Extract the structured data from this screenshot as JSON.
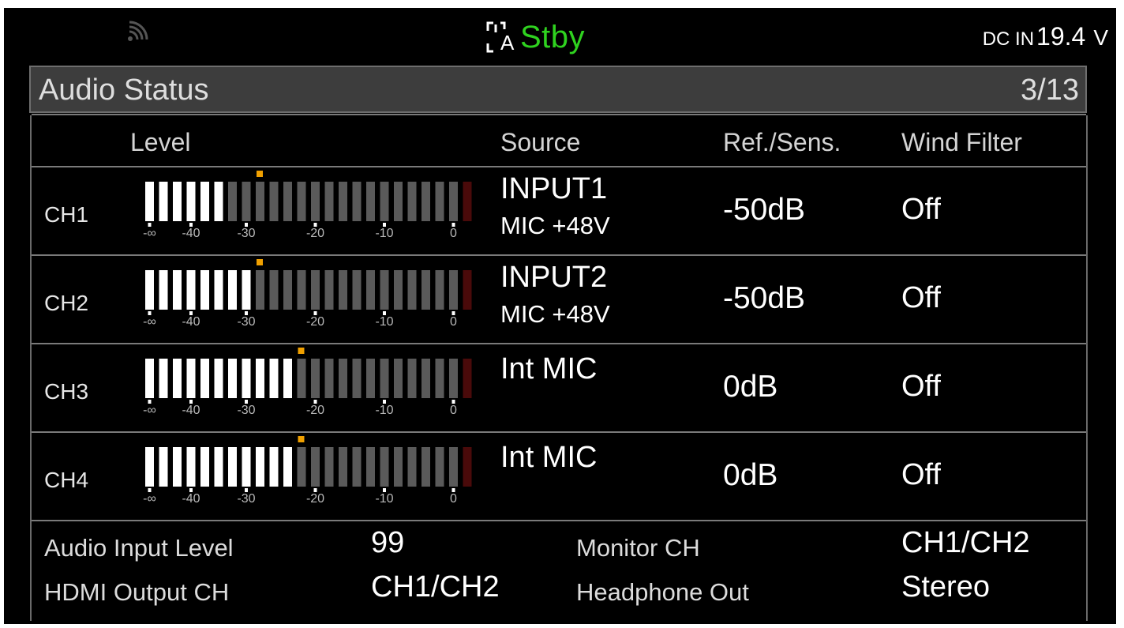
{
  "status_bar": {
    "wifi_icon": "wireless-signal-icon",
    "rec_icon": "rec-frame-a-icon",
    "rec_icon_text": "A",
    "record_status": "Stby",
    "record_status_color": "#2fd21f",
    "dc_in_label": "DC IN",
    "dc_in_value": "19.4",
    "dc_in_unit": "V"
  },
  "title_bar": {
    "title": "Audio Status",
    "page_counter": "3/13"
  },
  "table": {
    "headers": {
      "level": "Level",
      "source": "Source",
      "ref_sens": "Ref./Sens.",
      "wind_filter": "Wind Filter"
    },
    "scale_labels": [
      "-∞",
      "-40",
      "-30",
      "-20",
      "-10",
      "0"
    ],
    "channels": [
      {
        "name": "CH1",
        "source": "INPUT1",
        "source_detail": "MIC +48V",
        "ref_sens": "-50dB",
        "wind_filter": "Off",
        "level_lit_segments": 6,
        "level_peak_segment": 8
      },
      {
        "name": "CH2",
        "source": "INPUT2",
        "source_detail": "MIC +48V",
        "ref_sens": "-50dB",
        "wind_filter": "Off",
        "level_lit_segments": 8,
        "level_peak_segment": 8
      },
      {
        "name": "CH3",
        "source": "Int MIC",
        "source_detail": "",
        "ref_sens": "0dB",
        "wind_filter": "Off",
        "level_lit_segments": 11,
        "level_peak_segment": 11
      },
      {
        "name": "CH4",
        "source": "Int MIC",
        "source_detail": "",
        "ref_sens": "0dB",
        "wind_filter": "Off",
        "level_lit_segments": 11,
        "level_peak_segment": 11
      }
    ],
    "meter_segment_count": 24,
    "colors": {
      "lit": "#ffffff",
      "unlit": "#5a5a5a",
      "overload": "#4a0a0a",
      "peak_marker": "#f0a000"
    }
  },
  "info": {
    "audio_input_level_label": "Audio Input Level",
    "audio_input_level_value": "99",
    "hdmi_output_ch_label": "HDMI Output CH",
    "hdmi_output_ch_value": "CH1/CH2",
    "monitor_ch_label": "Monitor CH",
    "monitor_ch_value": "CH1/CH2",
    "headphone_out_label": "Headphone Out",
    "headphone_out_value": "Stereo"
  }
}
